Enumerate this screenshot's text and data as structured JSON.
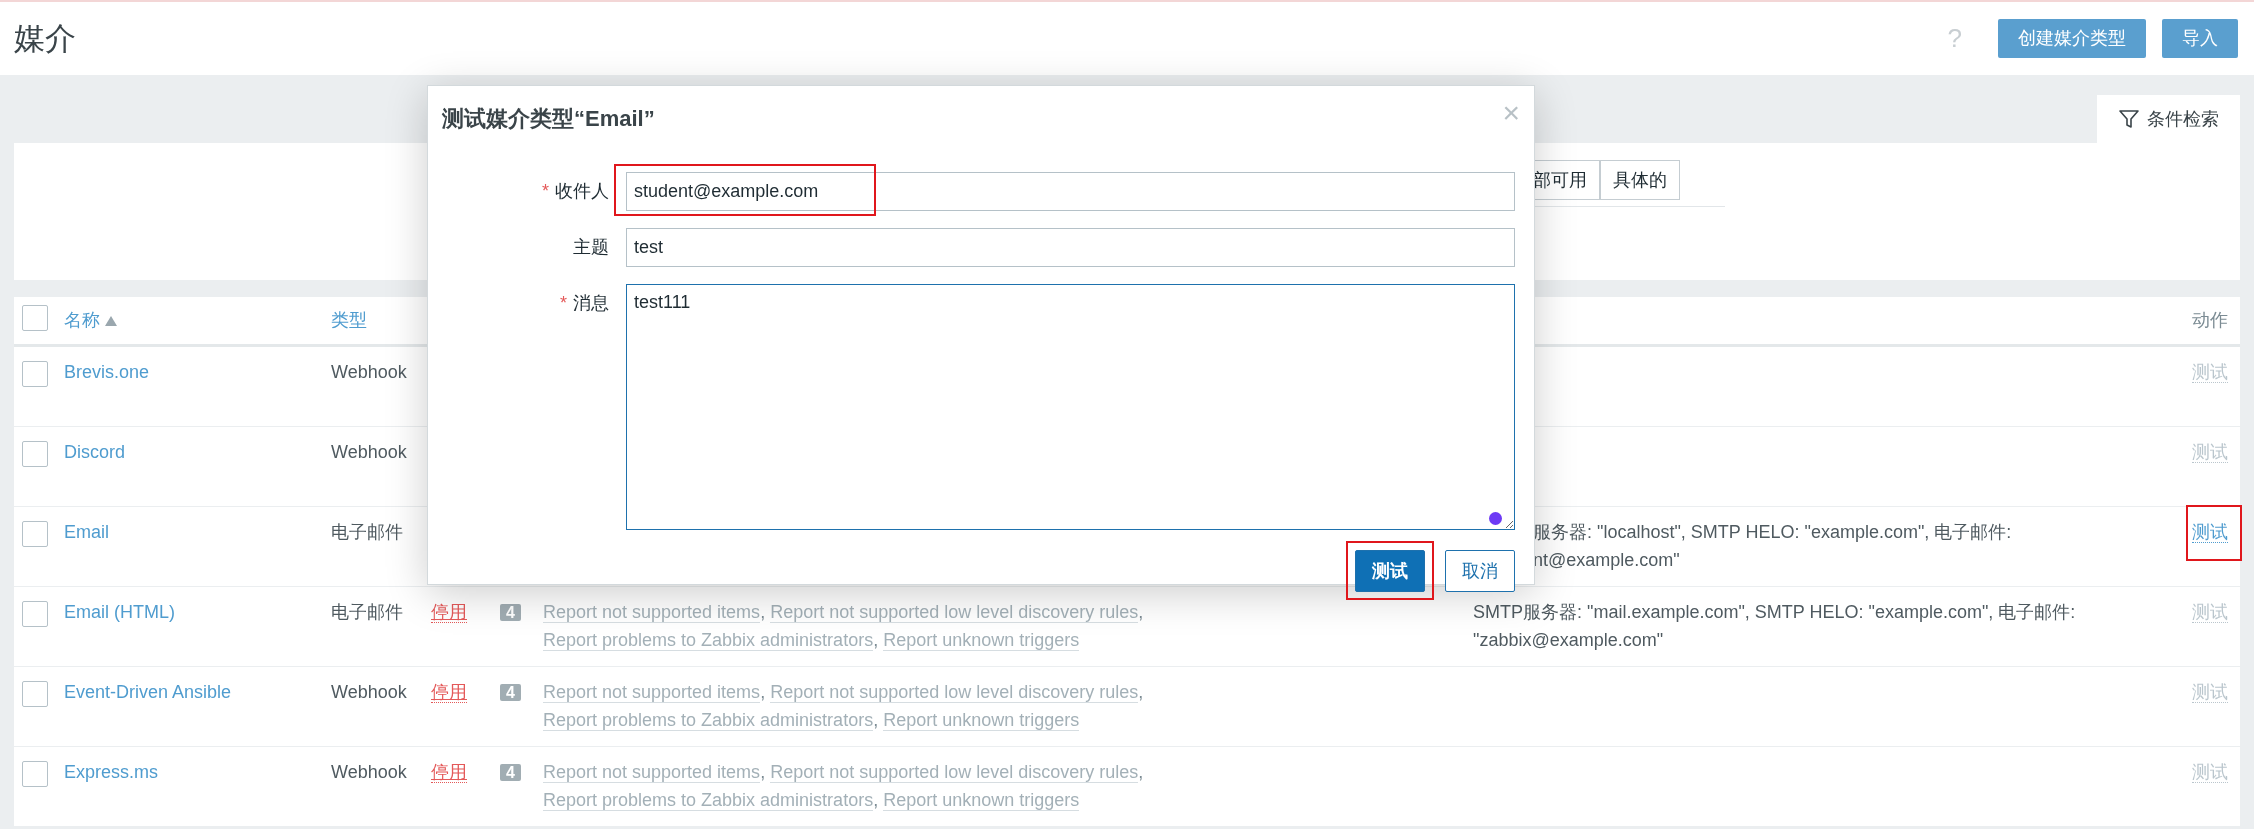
{
  "page": {
    "title": "媒介",
    "help": "?",
    "buttons": [
      "创建媒介类型",
      "导入"
    ]
  },
  "filter": {
    "tab_label": "条件检索",
    "segments": [
      {
        "label": "部可用",
        "selected": false
      },
      {
        "label": "具体的",
        "selected": false
      }
    ]
  },
  "table": {
    "all_checked": false,
    "template_separator": ",",
    "columns": [
      {
        "label": "名称",
        "sorted": true
      },
      {
        "label": "类型",
        "sorted": false
      },
      {
        "label": "动作",
        "sorted": false
      }
    ],
    "rows": [
      {
        "checked": false,
        "name": "Brevis.one",
        "type": "Webhook",
        "action": "测试",
        "disabled": true,
        "highlighted": false
      },
      {
        "checked": false,
        "name": "Discord",
        "type": "Webhook",
        "action": "测试",
        "disabled": true,
        "highlighted": false
      },
      {
        "checked": false,
        "name": "Email",
        "type": "电子邮件",
        "details": [
          "服务器: \"localhost\", SMTP HELO: \"example.com\", 电子邮件:",
          "nt@example.com\""
        ],
        "details_partly_hidden": true,
        "action": "测试",
        "disabled": false,
        "highlighted": true
      },
      {
        "checked": false,
        "name": "Email (HTML)",
        "type": "电子邮件",
        "status": "停用",
        "count": "4",
        "templates": [
          "Report not supported items",
          "Report not supported low level discovery rules",
          "Report problems to Zabbix administrators",
          "Report unknown triggers"
        ],
        "details": [
          "SMTP服务器: \"mail.example.com\", SMTP HELO: \"example.com\", 电子邮件:",
          "\"zabbix@example.com\""
        ],
        "details_partly_hidden": false,
        "action": "测试",
        "disabled": true,
        "highlighted": false
      },
      {
        "checked": false,
        "name": "Event-Driven Ansible",
        "type": "Webhook",
        "status": "停用",
        "count": "4",
        "templates": [
          "Report not supported items",
          "Report not supported low level discovery rules",
          "Report problems to Zabbix administrators",
          "Report unknown triggers"
        ],
        "action": "测试",
        "disabled": true,
        "highlighted": false
      },
      {
        "checked": false,
        "name": "Express.ms",
        "type": "Webhook",
        "status": "停用",
        "count": "4",
        "templates": [
          "Report not supported items",
          "Report not supported low level discovery rules",
          "Report problems to Zabbix administrators",
          "Report unknown triggers"
        ],
        "action": "测试",
        "disabled": true,
        "highlighted": false
      }
    ]
  },
  "dialog": {
    "title": "测试媒介类型“Email”",
    "close": "×",
    "required_mark": "*",
    "fields": [
      {
        "kind": "input",
        "label": "收件人",
        "required": true,
        "value": "student@example.com",
        "highlighted": true
      },
      {
        "kind": "input",
        "label": "主题",
        "required": false,
        "value": "test",
        "highlighted": false
      },
      {
        "kind": "textarea",
        "label": "消息",
        "required": true,
        "value": "test111",
        "highlighted": false
      }
    ],
    "buttons": [
      {
        "label": "测试",
        "primary": true,
        "highlighted": true
      },
      {
        "label": "取消",
        "primary": false,
        "highlighted": false
      }
    ]
  }
}
